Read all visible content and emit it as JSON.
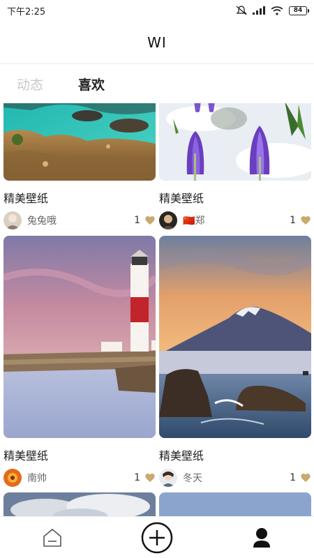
{
  "status_bar": {
    "time": "下午2:25",
    "battery": "84"
  },
  "header": {
    "title": "WI"
  },
  "tabs": [
    {
      "label": "动态",
      "active": false
    },
    {
      "label": "喜欢",
      "active": true
    }
  ],
  "cards": [
    {
      "title": "精美壁纸",
      "author": "兔兔哦",
      "likes": "1",
      "image": "coastal-rocks-turquoise-water"
    },
    {
      "title": "精美壁纸",
      "author": "🇨🇳郑",
      "likes": "1",
      "image": "purple-crocus-in-snow"
    },
    {
      "title": "精美壁纸",
      "author": "南帅",
      "likes": "1",
      "image": "lighthouse-sunset-coast"
    },
    {
      "title": "精美壁纸",
      "author": "冬天",
      "likes": "1",
      "image": "mount-fuji-sunset-sea"
    }
  ],
  "bottom_nav": [
    {
      "icon": "home-icon",
      "active": false
    },
    {
      "icon": "add-circle-icon",
      "active": false
    },
    {
      "icon": "profile-icon",
      "active": true
    }
  ],
  "colors": {
    "heart": "#c9a96e",
    "tab_active": "#222222",
    "tab_inactive": "#c8c8c8"
  }
}
